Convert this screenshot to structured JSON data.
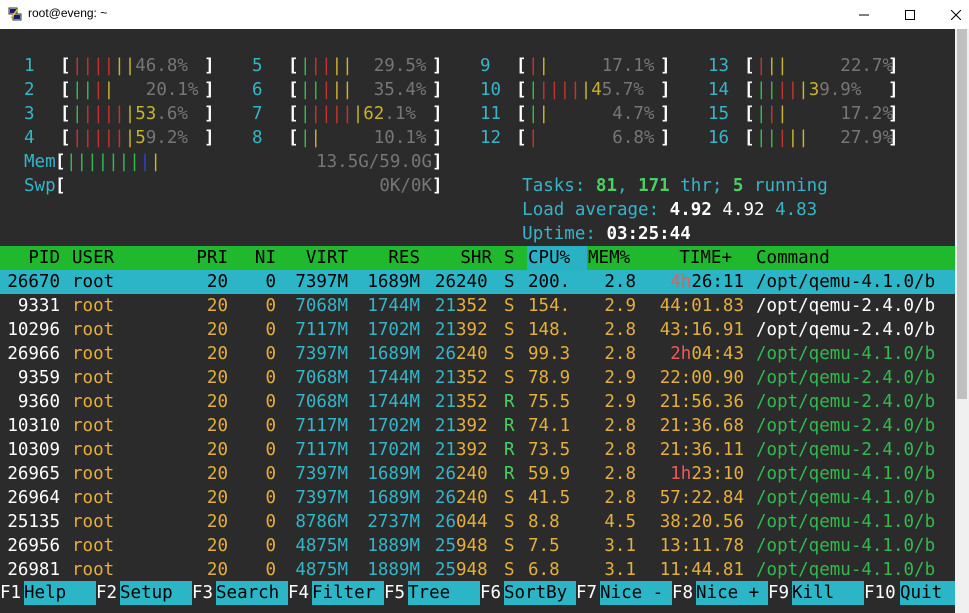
{
  "window": {
    "title": "root@eveng: ~",
    "icon": "putty-icon",
    "controls": {
      "minimize": "—",
      "maximize": "☐",
      "close": "✕"
    }
  },
  "cpus": [
    {
      "id": "1",
      "bar": [
        [
          "red",
          "||||"
        ],
        [
          "yellow",
          "||"
        ],
        [
          "gray",
          "46.8%"
        ]
      ],
      "pct": "46.8%"
    },
    {
      "id": "2",
      "bar": [
        [
          "green",
          "||"
        ],
        [
          "red",
          "|"
        ],
        [
          "yellow",
          "|"
        ],
        [
          "gray",
          "   20.1%"
        ]
      ],
      "pct": "20.1%"
    },
    {
      "id": "3",
      "bar": [
        [
          "green",
          "|"
        ],
        [
          "red",
          "||||"
        ],
        [
          "yellow",
          "|53"
        ],
        [
          "gray",
          ".6%"
        ]
      ],
      "pct": "53.6%"
    },
    {
      "id": "4",
      "bar": [
        [
          "red",
          "|||||"
        ],
        [
          "yellow",
          "|5"
        ],
        [
          "gray",
          "9.2%"
        ]
      ],
      "pct": "59.2%"
    },
    {
      "id": "5",
      "bar": [
        [
          "green",
          "|"
        ],
        [
          "red",
          "||"
        ],
        [
          "yellow",
          "||"
        ],
        [
          "gray",
          "  29.5%"
        ]
      ],
      "pct": "29.5%"
    },
    {
      "id": "6",
      "bar": [
        [
          "green",
          "||"
        ],
        [
          "red",
          "|"
        ],
        [
          "yellow",
          "||"
        ],
        [
          "gray",
          "  35.4%"
        ]
      ],
      "pct": "35.4%"
    },
    {
      "id": "7",
      "bar": [
        [
          "green",
          "|"
        ],
        [
          "red",
          "||||"
        ],
        [
          "yellow",
          "|62"
        ],
        [
          "gray",
          ".1%"
        ]
      ],
      "pct": "62.1%"
    },
    {
      "id": "8",
      "bar": [
        [
          "green",
          "|"
        ],
        [
          "yellow",
          "|"
        ],
        [
          "gray",
          "     10.1%"
        ]
      ],
      "pct": "10.1%"
    },
    {
      "id": "9",
      "bar": [
        [
          "red",
          "|"
        ],
        [
          "yellow",
          "|"
        ],
        [
          "gray",
          "     17.1%"
        ]
      ],
      "pct": "17.1%"
    },
    {
      "id": "10",
      "bar": [
        [
          "green",
          "|"
        ],
        [
          "red",
          "||||"
        ],
        [
          "yellow",
          "|4"
        ],
        [
          "gray",
          "5.7%"
        ]
      ],
      "pct": "45.7%"
    },
    {
      "id": "11",
      "bar": [
        [
          "green",
          "|"
        ],
        [
          "yellow",
          "|"
        ],
        [
          "gray",
          "      4.7%"
        ]
      ],
      "pct": "4.7%"
    },
    {
      "id": "12",
      "bar": [
        [
          "red",
          "|"
        ],
        [
          "gray",
          "       6.8%"
        ]
      ],
      "pct": "6.8%"
    },
    {
      "id": "13",
      "bar": [
        [
          "red",
          "|"
        ],
        [
          "yellow",
          "||"
        ],
        [
          "gray",
          "     22.7%"
        ]
      ],
      "pct": "22.7%"
    },
    {
      "id": "14",
      "bar": [
        [
          "green",
          "||"
        ],
        [
          "red",
          "||"
        ],
        [
          "yellow",
          "|3"
        ],
        [
          "gray",
          "9.9%"
        ]
      ],
      "pct": "39.9%"
    },
    {
      "id": "15",
      "bar": [
        [
          "green",
          "|"
        ],
        [
          "red",
          "|"
        ],
        [
          "yellow",
          "|"
        ],
        [
          "gray",
          "     17.2%"
        ]
      ],
      "pct": "17.2%"
    },
    {
      "id": "16",
      "bar": [
        [
          "green",
          "||"
        ],
        [
          "red",
          "|"
        ],
        [
          "yellow",
          "||"
        ],
        [
          "gray",
          "   27.9%"
        ]
      ],
      "pct": "27.9%"
    }
  ],
  "memory": {
    "mem_label": "Mem",
    "mem_bar": [
      [
        "green",
        "|||||||"
      ],
      [
        "blue",
        "|"
      ],
      [
        "yellow",
        "|"
      ]
    ],
    "mem_value": "13.5G/59.0G",
    "swp_label": "Swp",
    "swp_value": "0K/0K"
  },
  "summary": {
    "tasks_label": "Tasks: ",
    "tasks": "81",
    "sep1": ", ",
    "threads": "171",
    "thr_label": " thr; ",
    "running": "5",
    "running_label": " running",
    "load_label": "Load average: ",
    "load1": "4.92",
    "load5": "4.92",
    "load15": "4.83",
    "uptime_label": "Uptime: ",
    "uptime": "03:25:44"
  },
  "columns": {
    "pid": "PID",
    "user": "USER",
    "pri": "PRI",
    "ni": "NI",
    "virt": "VIRT",
    "res": "RES",
    "shr": "SHR",
    "s": "S",
    "cpu": "CPU%",
    "mem": "MEM%",
    "time": "TIME+",
    "command": "Command"
  },
  "processes": [
    {
      "pid": "26670",
      "user": "root",
      "pri": "20",
      "ni": "0",
      "virt": "7397M",
      "res": "1689M",
      "shr_a": "26",
      "shr_b": "240",
      "s": "S",
      "cpu": "200.",
      "mem": "2.8",
      "time_a": "4h",
      "time_b": "26:11",
      "command": "/opt/qemu-4.1.0/b",
      "selected": true
    },
    {
      "pid": "9331",
      "user": "root",
      "pri": "20",
      "ni": "0",
      "virt": "7068M",
      "res": "1744M",
      "shr_a": "21",
      "shr_b": "352",
      "s": "S",
      "cpu": "154.",
      "mem": "2.9",
      "time_a": "",
      "time_b": "44:01.83",
      "command": "/opt/qemu-2.4.0/b"
    },
    {
      "pid": "10296",
      "user": "root",
      "pri": "20",
      "ni": "0",
      "virt": "7117M",
      "res": "1702M",
      "shr_a": "21",
      "shr_b": "392",
      "s": "S",
      "cpu": "148.",
      "mem": "2.8",
      "time_a": "",
      "time_b": "43:16.91",
      "command": "/opt/qemu-2.4.0/b"
    },
    {
      "pid": "26966",
      "user": "root",
      "pri": "20",
      "ni": "0",
      "virt": "7397M",
      "res": "1689M",
      "shr_a": "26",
      "shr_b": "240",
      "s": "S",
      "cpu": "99.3",
      "mem": "2.8",
      "time_a": "2h",
      "time_b": "04:43",
      "command": "/opt/qemu-4.1.0/b"
    },
    {
      "pid": "9359",
      "user": "root",
      "pri": "20",
      "ni": "0",
      "virt": "7068M",
      "res": "1744M",
      "shr_a": "21",
      "shr_b": "352",
      "s": "S",
      "cpu": "78.9",
      "mem": "2.9",
      "time_a": "",
      "time_b": "22:00.90",
      "command": "/opt/qemu-2.4.0/b"
    },
    {
      "pid": "9360",
      "user": "root",
      "pri": "20",
      "ni": "0",
      "virt": "7068M",
      "res": "1744M",
      "shr_a": "21",
      "shr_b": "352",
      "s": "R",
      "cpu": "75.5",
      "mem": "2.9",
      "time_a": "",
      "time_b": "21:56.36",
      "command": "/opt/qemu-2.4.0/b"
    },
    {
      "pid": "10310",
      "user": "root",
      "pri": "20",
      "ni": "0",
      "virt": "7117M",
      "res": "1702M",
      "shr_a": "21",
      "shr_b": "392",
      "s": "R",
      "cpu": "74.1",
      "mem": "2.8",
      "time_a": "",
      "time_b": "21:36.68",
      "command": "/opt/qemu-2.4.0/b"
    },
    {
      "pid": "10309",
      "user": "root",
      "pri": "20",
      "ni": "0",
      "virt": "7117M",
      "res": "1702M",
      "shr_a": "21",
      "shr_b": "392",
      "s": "R",
      "cpu": "73.5",
      "mem": "2.8",
      "time_a": "",
      "time_b": "21:36.11",
      "command": "/opt/qemu-2.4.0/b"
    },
    {
      "pid": "26965",
      "user": "root",
      "pri": "20",
      "ni": "0",
      "virt": "7397M",
      "res": "1689M",
      "shr_a": "26",
      "shr_b": "240",
      "s": "R",
      "cpu": "59.9",
      "mem": "2.8",
      "time_a": "1h",
      "time_b": "23:10",
      "command": "/opt/qemu-4.1.0/b"
    },
    {
      "pid": "26964",
      "user": "root",
      "pri": "20",
      "ni": "0",
      "virt": "7397M",
      "res": "1689M",
      "shr_a": "26",
      "shr_b": "240",
      "s": "S",
      "cpu": "41.5",
      "mem": "2.8",
      "time_a": "",
      "time_b": "57:22.84",
      "command": "/opt/qemu-4.1.0/b"
    },
    {
      "pid": "25135",
      "user": "root",
      "pri": "20",
      "ni": "0",
      "virt": "8786M",
      "res": "2737M",
      "shr_a": "26",
      "shr_b": "044",
      "s": "S",
      "cpu": "8.8",
      "mem": "4.5",
      "time_a": "",
      "time_b": "38:20.56",
      "command": "/opt/qemu-4.1.0/b"
    },
    {
      "pid": "26956",
      "user": "root",
      "pri": "20",
      "ni": "0",
      "virt": "4875M",
      "res": "1889M",
      "shr_a": "25",
      "shr_b": "948",
      "s": "S",
      "cpu": "7.5",
      "mem": "3.1",
      "time_a": "",
      "time_b": "13:11.78",
      "command": "/opt/qemu-4.1.0/b"
    },
    {
      "pid": "26981",
      "user": "root",
      "pri": "20",
      "ni": "0",
      "virt": "4875M",
      "res": "1889M",
      "shr_a": "25",
      "shr_b": "948",
      "s": "S",
      "cpu": "6.8",
      "mem": "3.1",
      "time_a": "",
      "time_b": "11:44.81",
      "command": "/opt/qemu-4.1.0/b"
    }
  ],
  "function_keys": [
    {
      "key": "F1",
      "label": "Help  "
    },
    {
      "key": "F2",
      "label": "Setup "
    },
    {
      "key": "F3",
      "label": "Search"
    },
    {
      "key": "F4",
      "label": "Filter"
    },
    {
      "key": "F5",
      "label": "Tree  "
    },
    {
      "key": "F6",
      "label": "SortBy"
    },
    {
      "key": "F7",
      "label": "Nice -"
    },
    {
      "key": "F8",
      "label": "Nice +"
    },
    {
      "key": "F9",
      "label": "Kill  "
    },
    {
      "key": "F10",
      "label": "Quit  "
    }
  ],
  "colors": {
    "terminal_bg": "#2b2b2b",
    "header_green": "#20b82c",
    "highlight_cyan": "#2cb5c6"
  }
}
